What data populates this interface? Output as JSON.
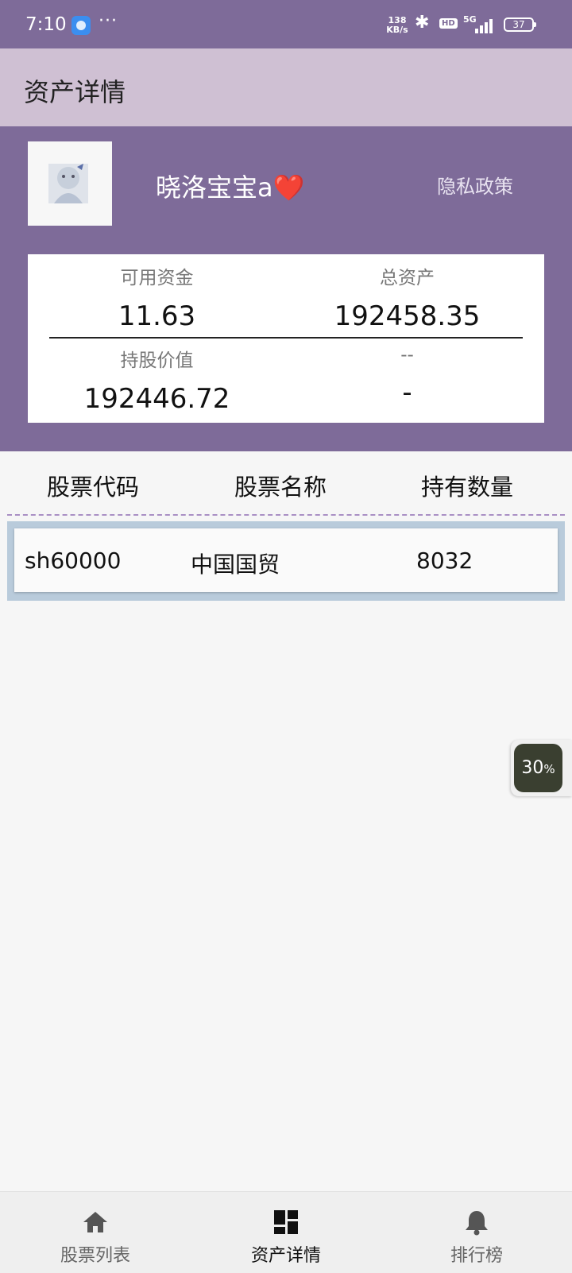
{
  "status_bar": {
    "time": "7:10",
    "dots": "···",
    "net_speed_value": "138",
    "net_speed_unit": "KB/s",
    "hd": "HD",
    "network": "5G",
    "battery": "37",
    "icons": [
      "app-notification-icon",
      "bluetooth-icon",
      "hd-icon",
      "signal-icon",
      "battery-icon"
    ]
  },
  "header": {
    "title": "资产详情"
  },
  "profile": {
    "username": "晓洛宝宝a❤️",
    "privacy_link": "隐私政策"
  },
  "assets": {
    "available_funds_label": "可用资金",
    "available_funds": "11.63",
    "total_assets_label": "总资产",
    "total_assets": "192458.35",
    "holdings_value_label": "持股价值",
    "holdings_value": "192446.72",
    "extra_label": "--",
    "extra_value": "-"
  },
  "table": {
    "columns": [
      "股票代码",
      "股票名称",
      "持有数量"
    ],
    "rows": [
      {
        "code": "sh60000",
        "name": "中国国贸",
        "quantity": "8032"
      }
    ]
  },
  "floating_widget": {
    "value": "30",
    "unit": "%"
  },
  "bottom_nav": {
    "items": [
      {
        "label": "股票列表",
        "icon": "home-icon",
        "active": false
      },
      {
        "label": "资产详情",
        "icon": "dashboard-icon",
        "active": true
      },
      {
        "label": "排行榜",
        "icon": "bell-icon",
        "active": false
      }
    ]
  },
  "colors": {
    "primary": "#7e6b99",
    "title_bar": "#cfc0d3",
    "row_frame": "#b9cbdb"
  }
}
